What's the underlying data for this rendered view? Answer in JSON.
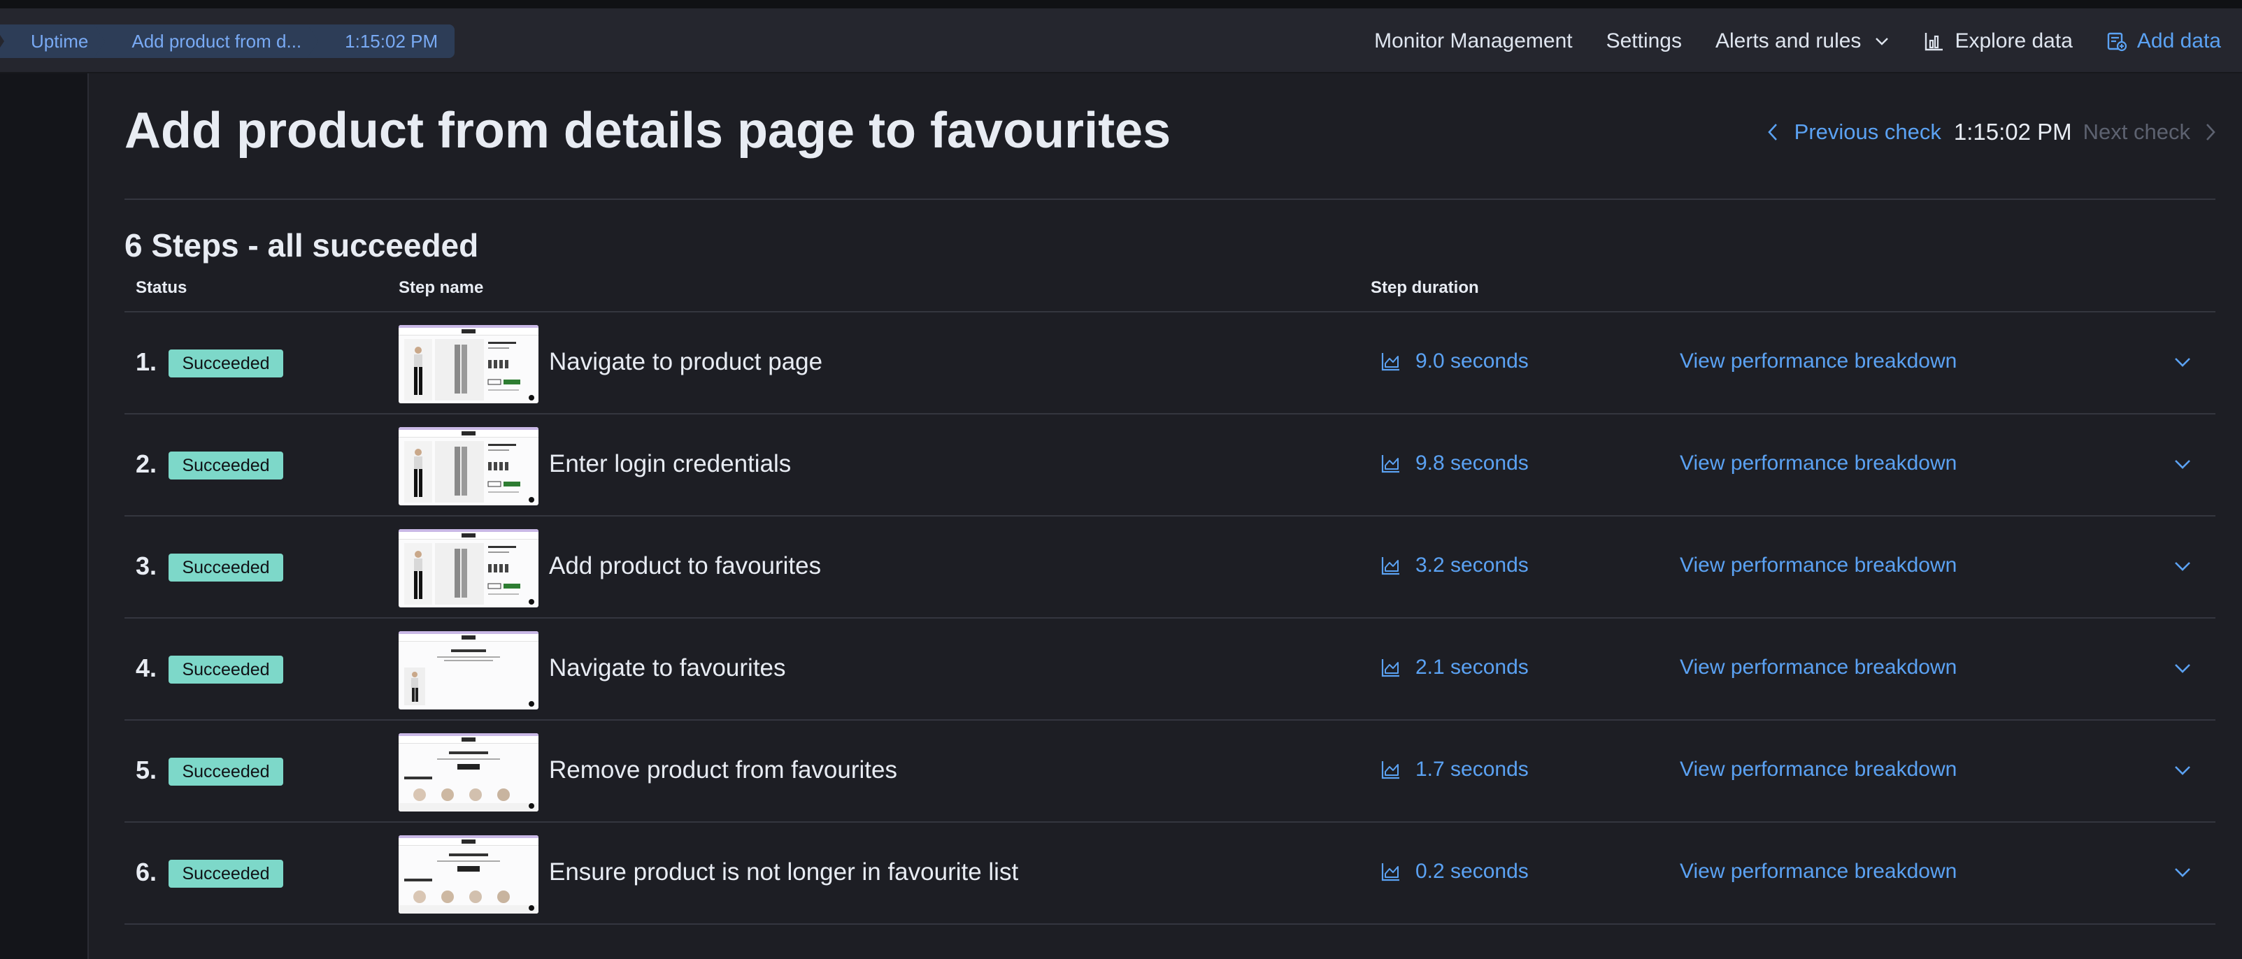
{
  "breadcrumbs": [
    "Uptime",
    "Add product from d...",
    "1:15:02 PM"
  ],
  "topnav": {
    "monitor_management": "Monitor Management",
    "settings": "Settings",
    "alerts_and_rules": "Alerts and rules",
    "explore_data": "Explore data",
    "add_data": "Add data"
  },
  "page": {
    "title": "Add product from details page to favourites",
    "previous_check": "Previous check",
    "current_time": "1:15:02 PM",
    "next_check": "Next check"
  },
  "steps_summary": "6 Steps - all succeeded",
  "columns": {
    "status": "Status",
    "step_name": "Step name",
    "step_duration": "Step duration"
  },
  "steps": [
    {
      "number": "1.",
      "status": "Succeeded",
      "name": "Navigate to product page",
      "duration": "9.0 seconds",
      "action": "View performance breakdown",
      "thumbnail": "product-page"
    },
    {
      "number": "2.",
      "status": "Succeeded",
      "name": "Enter login credentials",
      "duration": "9.8 seconds",
      "action": "View performance breakdown",
      "thumbnail": "product-page"
    },
    {
      "number": "3.",
      "status": "Succeeded",
      "name": "Add product to favourites",
      "duration": "3.2 seconds",
      "action": "View performance breakdown",
      "thumbnail": "product-page"
    },
    {
      "number": "4.",
      "status": "Succeeded",
      "name": "Navigate to favourites",
      "duration": "2.1 seconds",
      "action": "View performance breakdown",
      "thumbnail": "favourites-page"
    },
    {
      "number": "5.",
      "status": "Succeeded",
      "name": "Remove product from favourites",
      "duration": "1.7 seconds",
      "action": "View performance breakdown",
      "thumbnail": "empty-favourites-page"
    },
    {
      "number": "6.",
      "status": "Succeeded",
      "name": "Ensure product is not longer in favourite list",
      "duration": "0.2 seconds",
      "action": "View performance breakdown",
      "thumbnail": "empty-favourites-page"
    }
  ],
  "icons": {
    "breadcrumb_separator": "chevron-right-icon",
    "alerts_dropdown": "chevron-down-icon",
    "explore_data": "chart-icon",
    "add_data": "add-data-icon",
    "previous_check": "chevron-left-icon",
    "next_check": "chevron-right-icon",
    "duration": "area-chart-icon",
    "expand_row": "chevron-down-icon"
  },
  "colors": {
    "background": "#1d1e24",
    "header": "#25262e",
    "accent_link": "#5ba2f3",
    "breadcrumb_bg": "#2d3d57",
    "success_badge": "#7dd8c9",
    "text": "#e8ecf3"
  }
}
